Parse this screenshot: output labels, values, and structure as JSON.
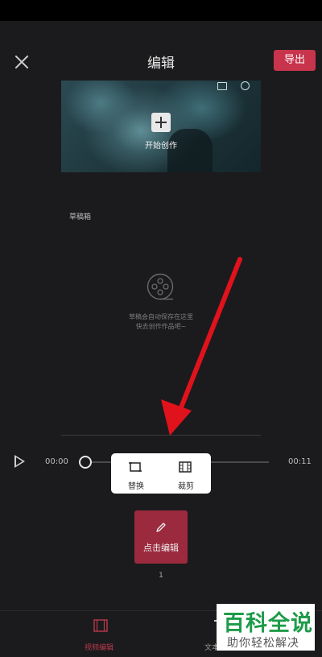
{
  "header": {
    "title": "编辑",
    "export_label": "导出"
  },
  "preview": {
    "start_label": "开始创作"
  },
  "drafts": {
    "label": "草稿箱",
    "empty_line1": "草稿会自动保存在这里",
    "empty_line2": "快去创作作品吧~"
  },
  "timeline": {
    "start_time": "00:00",
    "end_time": "00:11"
  },
  "popup": {
    "replace_label": "替换",
    "crop_label": "裁剪"
  },
  "edit_button": {
    "label": "点击编辑"
  },
  "clip_count": "1",
  "bottom_nav": {
    "video_edit_label": "视频编辑",
    "text_label": "文本"
  },
  "watermark": {
    "title": "百科全说",
    "subtitle": "助你轻松解决"
  },
  "colors": {
    "accent": "#c8344b",
    "edit_button": "#9c2a3e",
    "arrow": "#e0121b",
    "watermark_green": "#1e9b49"
  }
}
